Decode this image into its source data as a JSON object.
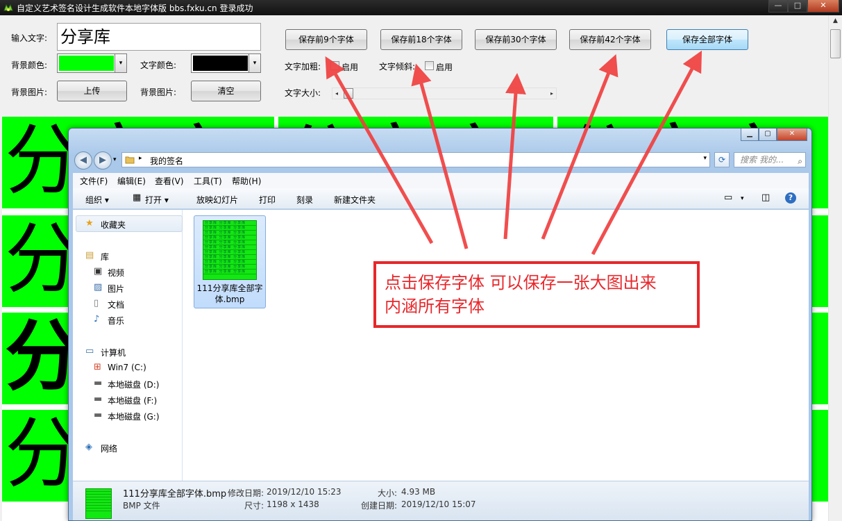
{
  "app": {
    "title": "自定义艺术签名设计生成软件本地字体版   bbs.fxku.cn  登录成功",
    "min_label": "—",
    "max_label": "□",
    "close_label": "✕"
  },
  "controls": {
    "input_text_label": "输入文字:",
    "input_text_value": "分享库",
    "bg_color_label": "背景颜色:",
    "bg_color": "#00ff00",
    "text_color_label": "文字颜色:",
    "text_color": "#000000",
    "bg_image_label_1": "背景图片:",
    "upload_label": "上传",
    "bg_image_label_2": "背景图片:",
    "clear_label": "清空",
    "save_buttons": [
      "保存前9个字体",
      "保存前18个字体",
      "保存前30个字体",
      "保存前42个字体",
      "保存全部字体"
    ],
    "bold_label": "文字加粗:",
    "bold_enable": "启用",
    "italic_label": "文字倾斜:",
    "italic_enable": "启用",
    "size_label": "文字大小:",
    "combo_arrow": "▾"
  },
  "preview": {
    "sample_text": "分享库",
    "cell_color": "#00ff00"
  },
  "explorer": {
    "back": "◀",
    "forward": "▶",
    "history": "▾",
    "crumb_sep": "▸",
    "address_folder": "我的签名",
    "address_dd": "▾",
    "refresh": "⟳",
    "search_placeholder": "搜索 我的...",
    "search_icon": "⌕",
    "menu": [
      "文件(F)",
      "编辑(E)",
      "查看(V)",
      "工具(T)",
      "帮助(H)"
    ],
    "toolbar": {
      "organize": "组织 ▾",
      "open": "打开 ▾",
      "slideshow": "放映幻灯片",
      "print": "打印",
      "burn": "刻录",
      "new_folder": "新建文件夹",
      "view_dd": "▾",
      "help": "?"
    },
    "nav": {
      "favorites": "收藏夹",
      "libraries": "库",
      "videos": "视频",
      "pictures": "图片",
      "documents": "文档",
      "music": "音乐",
      "computer": "计算机",
      "drive_c": "Win7 (C:)",
      "drive_d": "本地磁盘 (D:)",
      "drive_f": "本地磁盘 (F:)",
      "drive_g": "本地磁盘 (G:)",
      "network": "网络"
    },
    "file": {
      "name_line1": "111分享库全部字",
      "name_line2": "体.bmp",
      "thumb_row": "分享库 分享库 分享库"
    },
    "details": {
      "filename": "111分享库全部字体.bmp",
      "modified_label": "修改日期:",
      "modified_value": "2019/12/10 15:23",
      "size_label": "大小:",
      "size_value": "4.93 MB",
      "type": "BMP 文件",
      "dims_label": "尺寸:",
      "dims_value": "1198 x 1438",
      "created_label": "创建日期:",
      "created_value": "2019/12/10 15:07"
    }
  },
  "annotation": {
    "line1": "点击保存字体 可以保存一张大图出来",
    "line2": "内涵所有字体",
    "color": "#e8272b"
  }
}
